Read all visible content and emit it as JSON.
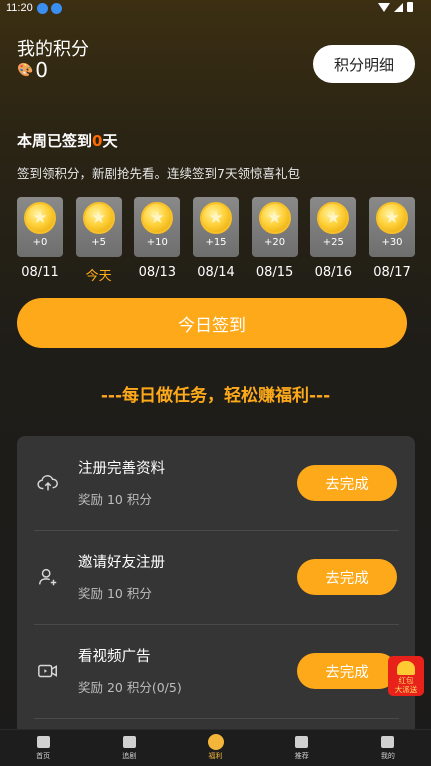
{
  "status_bar": {
    "time": "11:20"
  },
  "header": {
    "title": "我的积分",
    "points": "0",
    "detail_button": "积分明细"
  },
  "checkin": {
    "week_title_prefix": "本周已签到",
    "week_count": "0",
    "week_title_suffix": "天",
    "subtitle": "签到领积分，新剧抢先看。连续签到7天领惊喜礼包",
    "days": [
      {
        "bonus": "+0",
        "date": "08/11"
      },
      {
        "bonus": "+5",
        "date": "今天"
      },
      {
        "bonus": "+10",
        "date": "08/13"
      },
      {
        "bonus": "+15",
        "date": "08/14"
      },
      {
        "bonus": "+20",
        "date": "08/15"
      },
      {
        "bonus": "+25",
        "date": "08/16"
      },
      {
        "bonus": "+30",
        "date": "08/17"
      }
    ],
    "button": "今日签到"
  },
  "slogan": "---每日做任务，轻松赚福利---",
  "tasks": [
    {
      "name": "注册完善资料",
      "reward": "奖励 10 积分",
      "button": "去完成",
      "icon": "cloud-upload-icon"
    },
    {
      "name": "邀请好友注册",
      "reward": "奖励 10 积分",
      "button": "去完成",
      "icon": "add-user-icon"
    },
    {
      "name": "看视频广告",
      "reward": "奖励 20 积分(0/5)",
      "button": "去完成",
      "icon": "video-icon"
    }
  ],
  "red_packet": {
    "line1": "红包",
    "line2": "大派送"
  },
  "tabbar": [
    {
      "label": "首页",
      "icon": "home-icon"
    },
    {
      "label": "追剧",
      "icon": "star-icon"
    },
    {
      "label": "福利",
      "icon": "coin-icon",
      "active": true
    },
    {
      "label": "推荐",
      "icon": "play-icon"
    },
    {
      "label": "我的",
      "icon": "user-icon"
    }
  ],
  "colors": {
    "accent": "#fda91a",
    "highlight": "#ff6a00"
  }
}
